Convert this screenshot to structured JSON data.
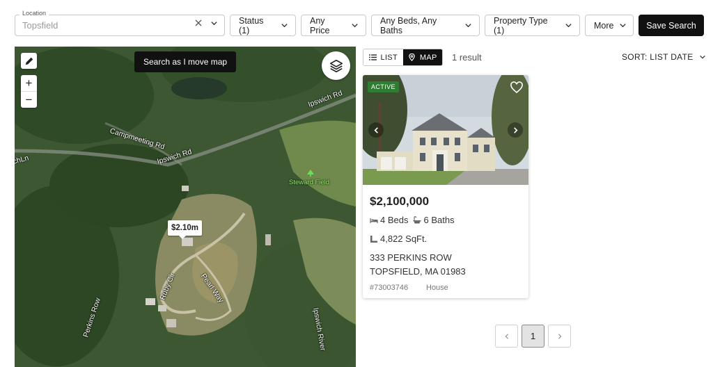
{
  "filters": {
    "location_label": "Location",
    "location_value": "Topsfield",
    "status": "Status (1)",
    "price": "Any Price",
    "beds_baths": "Any Beds, Any Baths",
    "property_type": "Property Type (1)",
    "more": "More",
    "save_search": "Save Search"
  },
  "map": {
    "search_as_move": "Search as I move map",
    "zoom_in": "+",
    "zoom_out": "−",
    "price_pin": "$2.10m",
    "labels": {
      "ipswich_rd_1": "Ipswich Rd",
      "ipswich_rd_2": "Ipswich Rd",
      "campmeeting_rd": "Campmeeting Rd",
      "ruby_cir": "Ruby Cir",
      "pearl_way": "Pearl Way",
      "perkins_row": "Perkins Row",
      "ipswich_river": "Ipswich River",
      "left_edge": "chLn",
      "steward_field": "Steward Field"
    }
  },
  "results": {
    "view_list": "LIST",
    "view_map": "MAP",
    "count": "1 result",
    "sort": "SORT: LIST DATE"
  },
  "listing": {
    "status_badge": "ACTIVE",
    "price": "$2,100,000",
    "beds": "4 Beds",
    "baths": "6 Baths",
    "sqft": "4,822 SqFt.",
    "address_line1": "333 PERKINS ROW",
    "address_line2": "TOPSFIELD, MA 01983",
    "mls": "#73003746",
    "type": "House"
  },
  "pagination": {
    "current_page": "1"
  },
  "colors": {
    "primary_button": "#111111",
    "active_badge": "#2e7d32",
    "park_label": "#9ee37d"
  }
}
